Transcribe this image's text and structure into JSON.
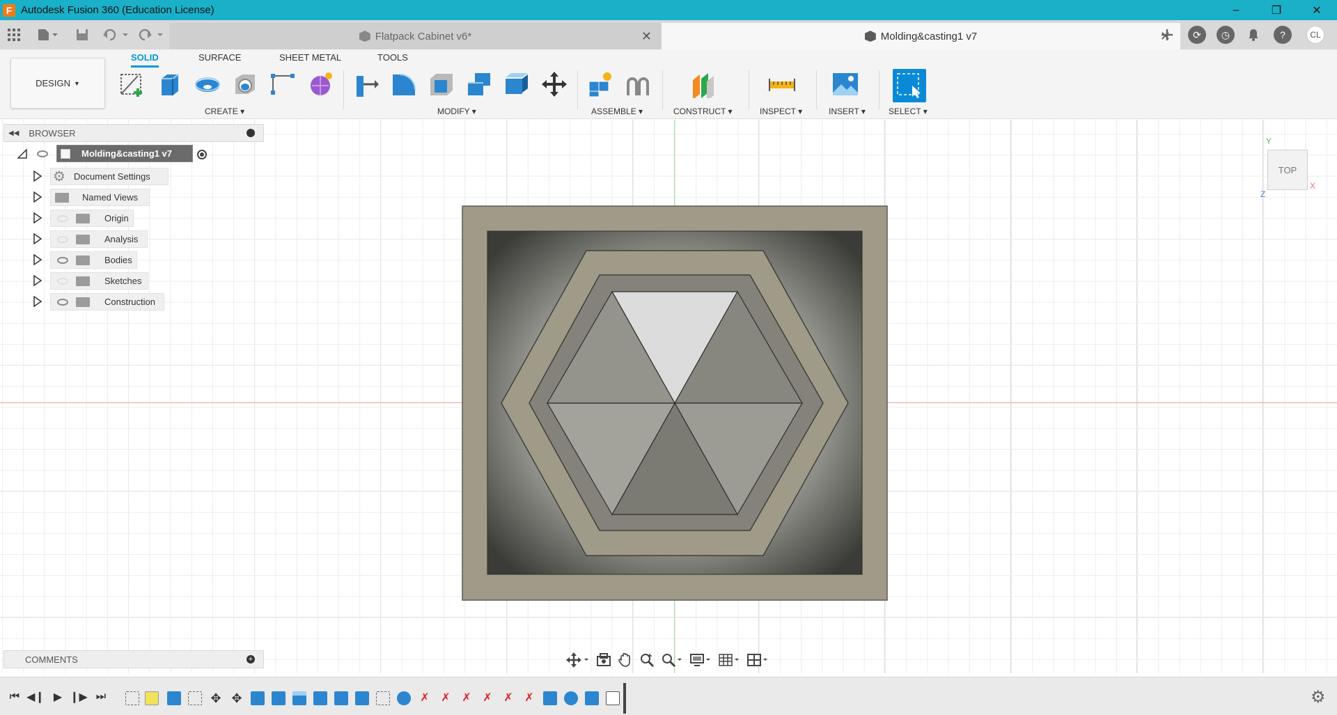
{
  "window": {
    "title": "Autodesk Fusion 360 (Education License)",
    "app_logo": "F"
  },
  "tabs": [
    {
      "label": "Flatpack Cabinet v6*"
    },
    {
      "label": "Molding&casting1 v7"
    }
  ],
  "user": {
    "initials": "CL"
  },
  "toolbar": {
    "workspace": "DESIGN",
    "workspace_tabs": [
      "SOLID",
      "SURFACE",
      "SHEET METAL",
      "TOOLS"
    ],
    "groups": [
      "CREATE",
      "MODIFY",
      "ASSEMBLE",
      "CONSTRUCT",
      "INSPECT",
      "INSERT",
      "SELECT"
    ]
  },
  "browser": {
    "title": "BROWSER",
    "root": "Molding&casting1 v7",
    "items": [
      {
        "label": "Document Settings",
        "icon": "gear-icon"
      },
      {
        "label": "Named Views",
        "icon": "folder-icon"
      },
      {
        "label": "Origin",
        "icon": "folder-icon",
        "visibility": "hidden"
      },
      {
        "label": "Analysis",
        "icon": "folder-icon",
        "visibility": "hidden"
      },
      {
        "label": "Bodies",
        "icon": "folder-icon",
        "visibility": "visible"
      },
      {
        "label": "Sketches",
        "icon": "folder-icon",
        "visibility": "hidden"
      },
      {
        "label": "Construction",
        "icon": "folder-icon",
        "visibility": "visible"
      }
    ]
  },
  "comments": {
    "title": "COMMENTS"
  },
  "viewcube": {
    "face": "TOP",
    "axis_x": "X",
    "axis_y": "Y",
    "axis_z": "Z"
  },
  "colors": {
    "titlebar": "#1ab0c8",
    "accent": "#0696d7",
    "model_frame": "#a09a88",
    "model_shadow": "#3a3a36"
  }
}
